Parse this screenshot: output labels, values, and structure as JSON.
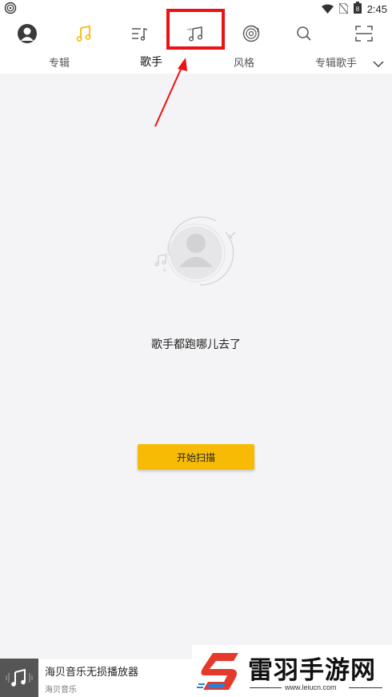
{
  "status_bar": {
    "time": "2:45",
    "battery_level": "8"
  },
  "top_nav": {
    "active_color": "#f7bb05",
    "icons": [
      "avatar-icon",
      "music-note-icon",
      "playlist-icon",
      "artist-music-icon",
      "disc-icon",
      "search-icon",
      "scan-icon"
    ]
  },
  "sub_tabs": {
    "tabs": [
      "专辑",
      "歌手",
      "风格",
      "专辑歌手"
    ],
    "active_index": 1
  },
  "empty_state": {
    "message": "歌手都跑哪儿去了",
    "button_label": "开始扫描",
    "button_color": "#f7bb05"
  },
  "player": {
    "title": "海贝音乐无损播放器",
    "subtitle": "海贝音乐"
  },
  "watermark": {
    "name": "雷羽手游网",
    "url": "www.leiucn.com"
  },
  "annotation": {
    "box_color": "#ee1111"
  }
}
